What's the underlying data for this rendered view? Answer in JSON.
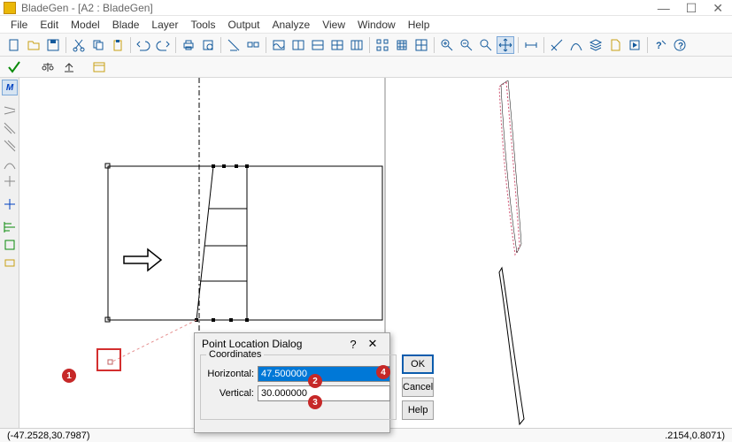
{
  "title": "BladeGen - [A2 : BladeGen]",
  "menu": [
    "File",
    "Edit",
    "Model",
    "Blade",
    "Layer",
    "Tools",
    "Output",
    "Analyze",
    "View",
    "Window",
    "Help"
  ],
  "dialog": {
    "title": "Point Location Dialog",
    "helpGlyph": "?",
    "closeGlyph": "✕",
    "groupLabel": "Coordinates",
    "horizontalLabel": "Horizontal:",
    "horizontalValue": "47.500000",
    "verticalLabel": "Vertical:",
    "verticalValue": "30.000000",
    "ok": "OK",
    "cancel": "Cancel",
    "help": "Help"
  },
  "status": {
    "left": "(-47.2528,30.7987)",
    "right": ".2154,0.8071)"
  },
  "badges": {
    "b1": "1",
    "b2": "2",
    "b3": "3",
    "b4": "4"
  }
}
